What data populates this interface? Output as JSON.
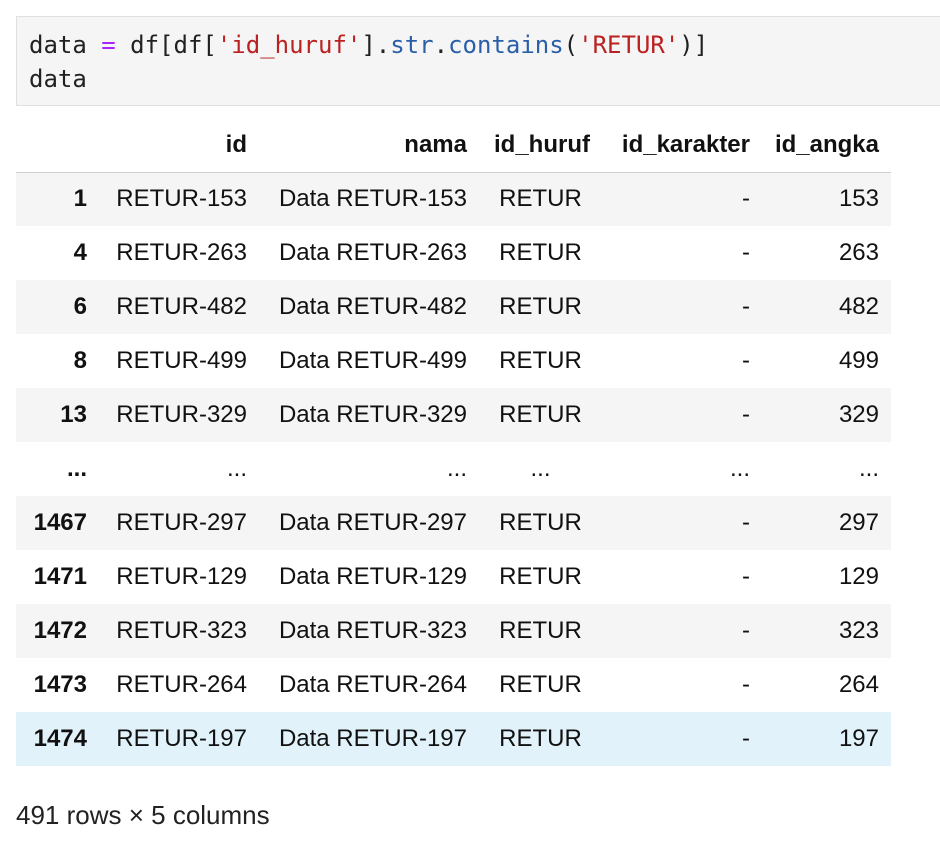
{
  "code_cell": {
    "line1": {
      "var": "data",
      "assign": "=",
      "expr_start": "df[df[",
      "column": "'id_huruf'",
      "dot1": "].",
      "accessor": "str",
      "dot2": ".",
      "method": "contains",
      "open_paren": "(",
      "pattern": "'RETUR'",
      "close": ")]"
    },
    "line2": "data"
  },
  "table": {
    "columns": [
      "",
      "id",
      "nama",
      "id_huruf",
      "id_karakter",
      "id_angka"
    ],
    "rows": [
      {
        "index": "1",
        "id": "RETUR-153",
        "nama": "Data RETUR-153",
        "id_huruf": "RETUR",
        "id_karakter": "-",
        "id_angka": "153"
      },
      {
        "index": "4",
        "id": "RETUR-263",
        "nama": "Data RETUR-263",
        "id_huruf": "RETUR",
        "id_karakter": "-",
        "id_angka": "263"
      },
      {
        "index": "6",
        "id": "RETUR-482",
        "nama": "Data RETUR-482",
        "id_huruf": "RETUR",
        "id_karakter": "-",
        "id_angka": "482"
      },
      {
        "index": "8",
        "id": "RETUR-499",
        "nama": "Data RETUR-499",
        "id_huruf": "RETUR",
        "id_karakter": "-",
        "id_angka": "499"
      },
      {
        "index": "13",
        "id": "RETUR-329",
        "nama": "Data RETUR-329",
        "id_huruf": "RETUR",
        "id_karakter": "-",
        "id_angka": "329"
      },
      {
        "index": "...",
        "id": "...",
        "nama": "...",
        "id_huruf": "...",
        "id_karakter": "...",
        "id_angka": "..."
      },
      {
        "index": "1467",
        "id": "RETUR-297",
        "nama": "Data RETUR-297",
        "id_huruf": "RETUR",
        "id_karakter": "-",
        "id_angka": "297"
      },
      {
        "index": "1471",
        "id": "RETUR-129",
        "nama": "Data RETUR-129",
        "id_huruf": "RETUR",
        "id_karakter": "-",
        "id_angka": "129"
      },
      {
        "index": "1472",
        "id": "RETUR-323",
        "nama": "Data RETUR-323",
        "id_huruf": "RETUR",
        "id_karakter": "-",
        "id_angka": "323"
      },
      {
        "index": "1473",
        "id": "RETUR-264",
        "nama": "Data RETUR-264",
        "id_huruf": "RETUR",
        "id_karakter": "-",
        "id_angka": "264"
      },
      {
        "index": "1474",
        "id": "RETUR-197",
        "nama": "Data RETUR-197",
        "id_huruf": "RETUR",
        "id_karakter": "-",
        "id_angka": "197"
      }
    ]
  },
  "footer": {
    "summary": "491 rows × 5 columns"
  },
  "colors": {
    "code_background": "#f5f5f5",
    "striped_row": "#f5f5f5",
    "hovered_row": "#e1f2fb",
    "keyword_operator": "#aa22ff",
    "string_literal": "#ba2121",
    "attribute": "#2a5fa8"
  }
}
